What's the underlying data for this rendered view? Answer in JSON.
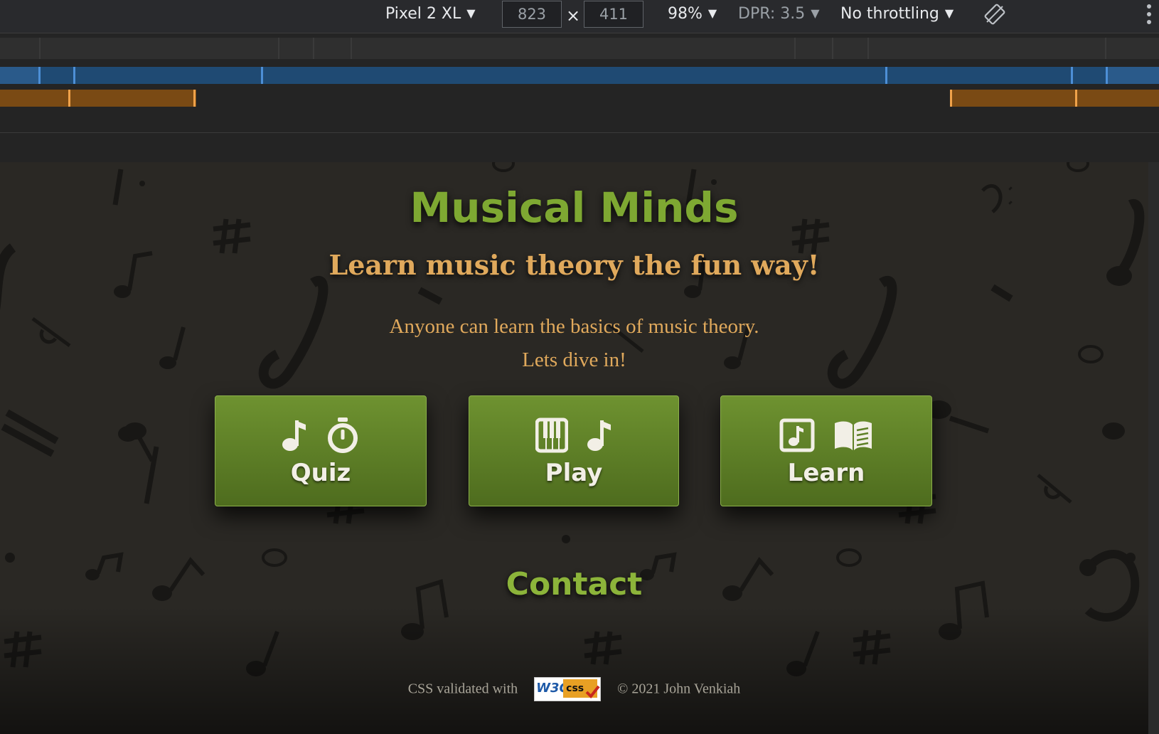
{
  "devtools": {
    "device_label": "Pixel 2 XL",
    "width": "823",
    "height": "411",
    "times": "×",
    "zoom": "98%",
    "dpr": "DPR: 3.5",
    "throttling": "No throttling"
  },
  "page": {
    "title": "Musical Minds",
    "tagline": "Learn music theory the fun way!",
    "intro_line1": "Anyone can learn the basics of music theory.",
    "intro_line2": "Lets dive in!",
    "buttons": [
      {
        "label": "Quiz",
        "icons": [
          "music-note-icon",
          "stopwatch-icon"
        ]
      },
      {
        "label": "Play",
        "icons": [
          "piano-keys-icon",
          "music-note-icon"
        ]
      },
      {
        "label": "Learn",
        "icons": [
          "music-file-icon",
          "open-book-icon"
        ]
      }
    ],
    "contact": "Contact",
    "footer": {
      "validated_text": "CSS validated with",
      "badge_w3c": "W3C",
      "badge_css": "css",
      "copyright": "© 2021 John Venkiah"
    }
  },
  "colors": {
    "title": "#7ea832",
    "tagline": "#e0a95c",
    "button": "#5e8026",
    "contact": "#8cb43a",
    "media_query_max_width": "#1f4a73",
    "media_query_min_width": "#7a4a14"
  }
}
